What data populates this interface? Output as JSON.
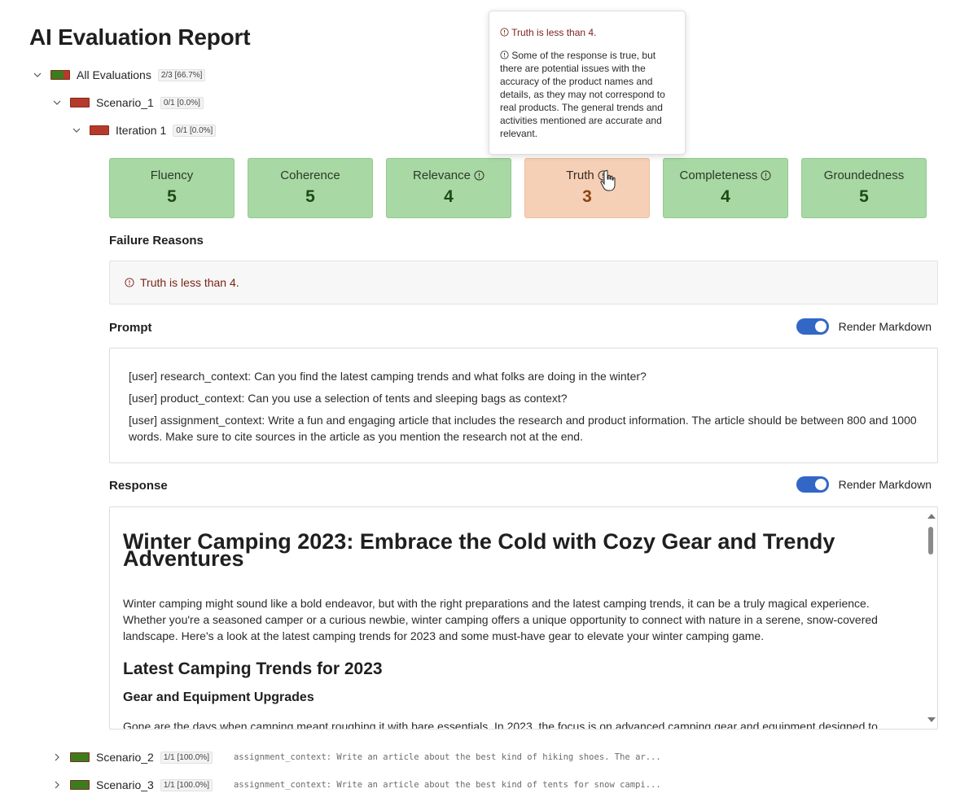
{
  "report": {
    "title": "AI Evaluation Report"
  },
  "tree": {
    "root": {
      "label": "All Evaluations",
      "badge": "2/3 [66.7%]",
      "pass_ratio": 0.667
    },
    "scenario_1": {
      "label": "Scenario_1",
      "badge": "0/1 [0.0%]",
      "pass_ratio": 0
    },
    "iteration_1": {
      "label": "Iteration 1",
      "badge": "0/1 [0.0%]",
      "pass_ratio": 0
    },
    "scenario_2": {
      "label": "Scenario_2",
      "badge": "1/1 [100.0%]",
      "pass_ratio": 1,
      "preview": "assignment_context: Write an article about the best kind of hiking shoes. The ar..."
    },
    "scenario_3": {
      "label": "Scenario_3",
      "badge": "1/1 [100.0%]",
      "pass_ratio": 1,
      "preview": "assignment_context: Write an article about the best kind of tents for snow campi..."
    }
  },
  "metrics": [
    {
      "name": "Fluency",
      "score": "5",
      "status": "pass",
      "info": false
    },
    {
      "name": "Coherence",
      "score": "5",
      "status": "pass",
      "info": false
    },
    {
      "name": "Relevance",
      "score": "4",
      "status": "pass",
      "info": true
    },
    {
      "name": "Truth",
      "score": "3",
      "status": "warn",
      "info": true
    },
    {
      "name": "Completeness",
      "score": "4",
      "status": "pass",
      "info": true
    },
    {
      "name": "Groundedness",
      "score": "5",
      "status": "pass",
      "info": false
    }
  ],
  "tooltip": {
    "reason": "Truth is less than 4.",
    "explanation": "Some of the response is true, but there are potential issues with the accuracy of the product names and details, as they may not correspond to real products. The general trends and activities mentioned are accurate and relevant."
  },
  "failure": {
    "heading": "Failure Reasons",
    "reason": "Truth is less than 4."
  },
  "prompt": {
    "heading": "Prompt",
    "toggle_label": "Render Markdown",
    "toggle_on": true,
    "lines": [
      "[user] research_context: Can you find the latest camping trends and what folks are doing in the winter?",
      "[user] product_context: Can you use a selection of tents and sleeping bags as context?",
      "[user] assignment_context: Write a fun and engaging article that includes the research and product information. The article should be between 800 and 1000 words. Make sure to cite sources in the article as you mention the research not at the end."
    ]
  },
  "response": {
    "heading": "Response",
    "toggle_label": "Render Markdown",
    "toggle_on": true,
    "h1": "Winter Camping 2023: Embrace the Cold with Cozy Gear and Trendy Adventures",
    "intro": "Winter camping might sound like a bold endeavor, but with the right preparations and the latest camping trends, it can be a truly magical experience. Whether you're a seasoned camper or a curious newbie, winter camping offers a unique opportunity to connect with nature in a serene, snow-covered landscape. Here's a look at the latest camping trends for 2023 and some must-have gear to elevate your winter camping game.",
    "h2": "Latest Camping Trends for 2023",
    "h3": "Gear and Equipment Upgrades",
    "para2": "Gone are the days when camping meant roughing it with bare essentials. In 2023, the focus is on advanced camping gear and equipment designed to enhance comfort and convenience. Brands like Alpine Gear and Outdoor Living lead the charge with their innovative products."
  },
  "colors": {
    "pass": "#a8d8a3",
    "warn": "#f5d0b6",
    "accent": "#3267c6",
    "fail_text": "#7a2418"
  }
}
